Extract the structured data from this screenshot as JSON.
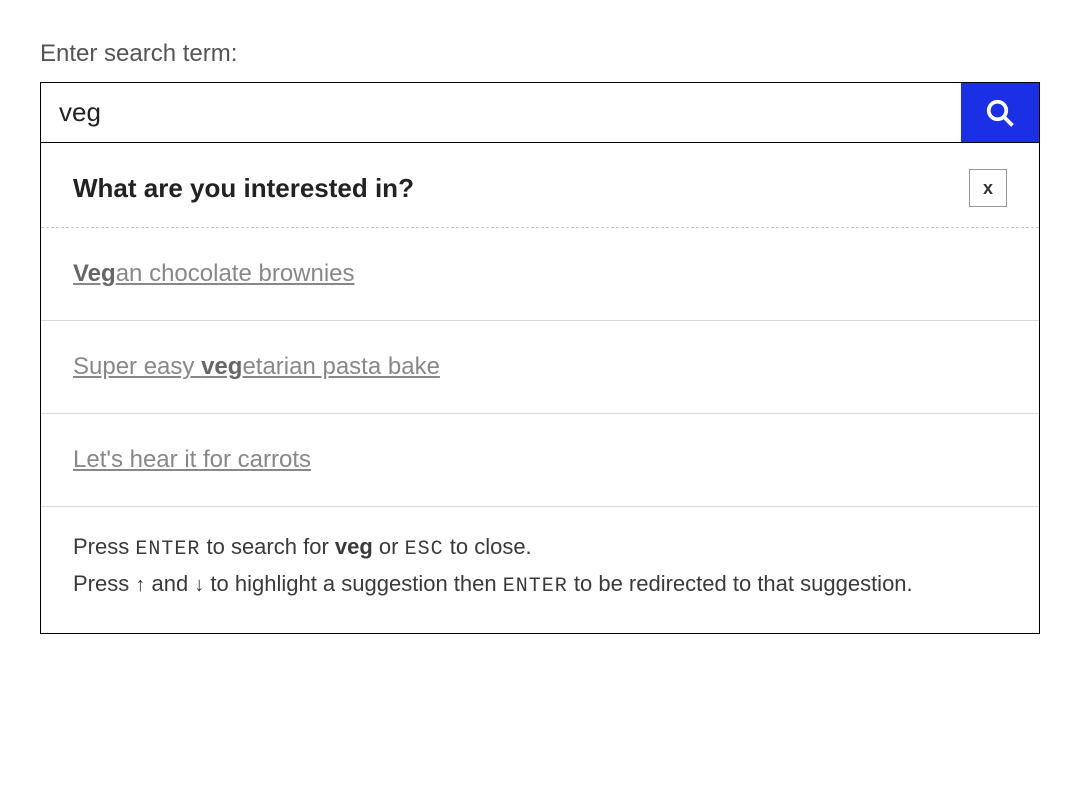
{
  "search": {
    "label": "Enter search term:",
    "value": "veg",
    "placeholder": ""
  },
  "dropdown": {
    "title": "What are you interested in?",
    "close_label": "x",
    "suggestions": [
      {
        "prefix": "",
        "highlight": "Veg",
        "suffix": "an chocolate brownies"
      },
      {
        "prefix": "Super easy ",
        "highlight": "veg",
        "suffix": "etarian pasta bake"
      },
      {
        "prefix": "",
        "highlight": "",
        "suffix": "Let's hear it for carrots"
      }
    ],
    "instructions": {
      "line1_a": "Press ",
      "line1_key1": "ENTER",
      "line1_b": " to search for ",
      "line1_term": "veg",
      "line1_c": " or ",
      "line1_key2": "ESC",
      "line1_d": " to close.",
      "line2_a": "Press ",
      "line2_up": "↑",
      "line2_b": " and ",
      "line2_down": "↓",
      "line2_c": " to highlight a suggestion then ",
      "line2_key": "ENTER",
      "line2_d": " to be redirected to that suggestion."
    }
  }
}
